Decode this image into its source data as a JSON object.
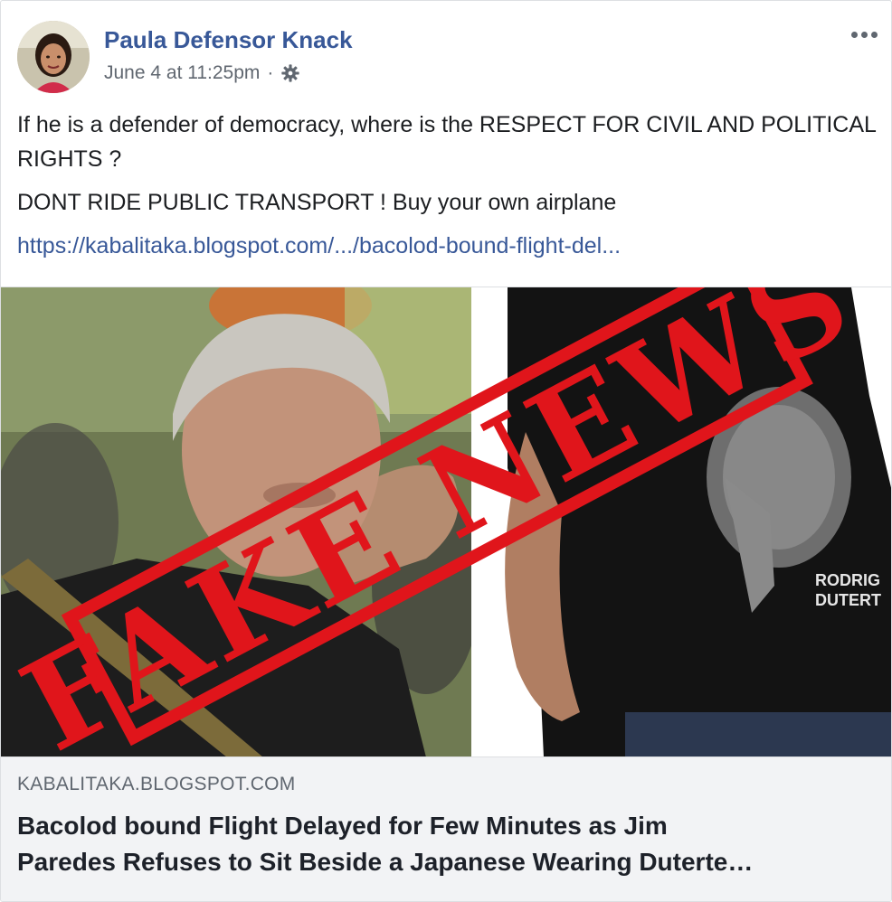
{
  "post": {
    "author": "Paula Defensor Knack",
    "timestamp": "June 4 at 11:25pm",
    "separator": "·",
    "privacy_icon": "gear-icon",
    "more_icon": "more-options-icon",
    "paragraph_1": "If he is a defender of democracy, where is the RESPECT FOR CIVIL AND POLITICAL RIGHTS ?",
    "paragraph_2": "DONT RIDE PUBLIC TRANSPORT ! Buy your own airplane",
    "link_text": "https://kabalitaka.blogspot.com/.../bacolod-bound-flight-del..."
  },
  "image": {
    "stamp_text": "FAKE NEWS",
    "shirt_text_1": "RODRIG",
    "shirt_text_2": "DUTERT"
  },
  "preview": {
    "domain": "KABALITAKA.BLOGSPOT.COM",
    "headline_line_1": "Bacolod bound Flight Delayed for Few Minutes as Jim",
    "headline_line_2": "Paredes Refuses to Sit Beside a Japanese Wearing Duterte…"
  },
  "colors": {
    "link": "#385898",
    "meta": "#606770",
    "stamp_red": "#e0151b",
    "preview_bg": "#f2f3f5"
  }
}
